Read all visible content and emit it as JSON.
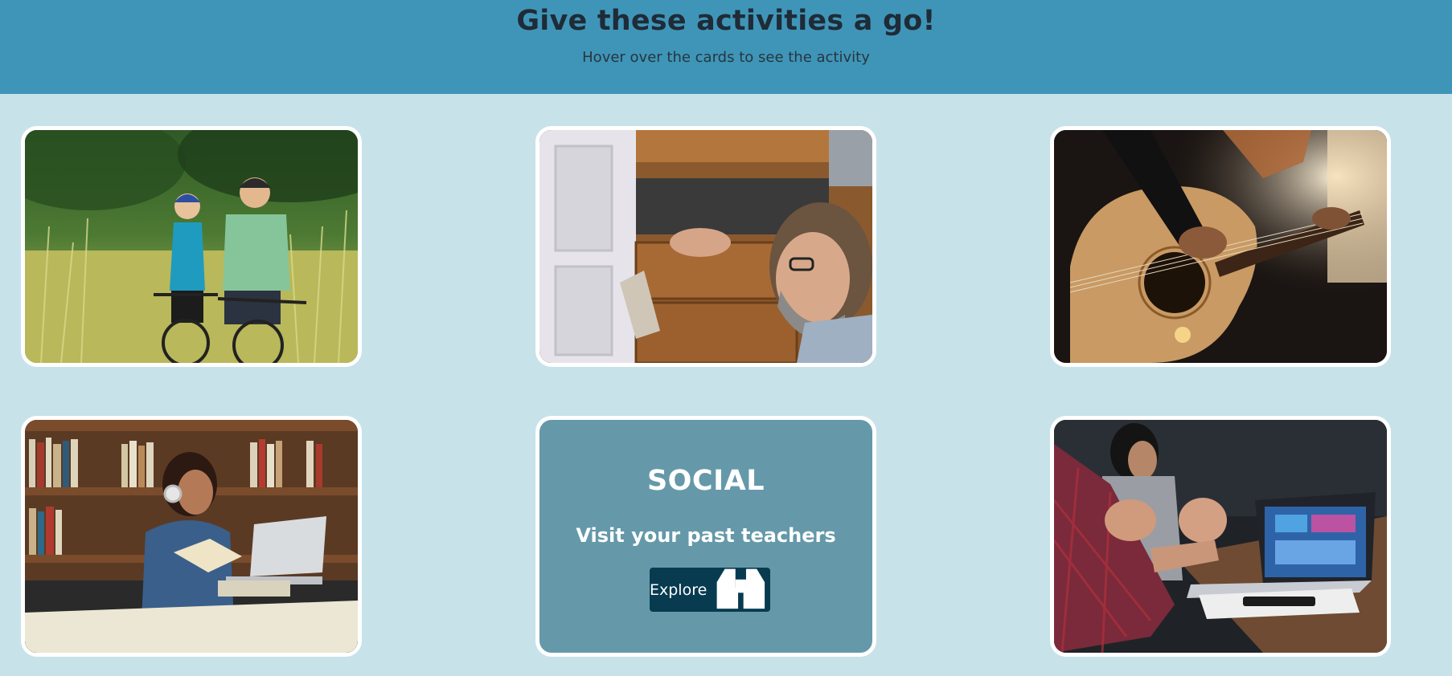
{
  "header": {
    "title": "Give these activities a go!",
    "subtitle": "Hover over the cards to see the activity"
  },
  "cards": [
    {
      "image": "couple-cycling-photo"
    },
    {
      "image": "man-repairing-drawer-photo"
    },
    {
      "image": "playing-acoustic-guitar-photo"
    },
    {
      "image": "woman-reading-with-headphones-photo"
    },
    {
      "category": "SOCIAL",
      "description": "Visit your past teachers",
      "button_label": "Explore",
      "button_icon": "binoculars-icon"
    },
    {
      "image": "people-meeting-laptop-photo"
    }
  ],
  "colors": {
    "header_bg": "#3f95b7",
    "page_bg": "#c8e2ea",
    "card_back_bg": "#6599a9",
    "button_bg": "#083b50"
  }
}
